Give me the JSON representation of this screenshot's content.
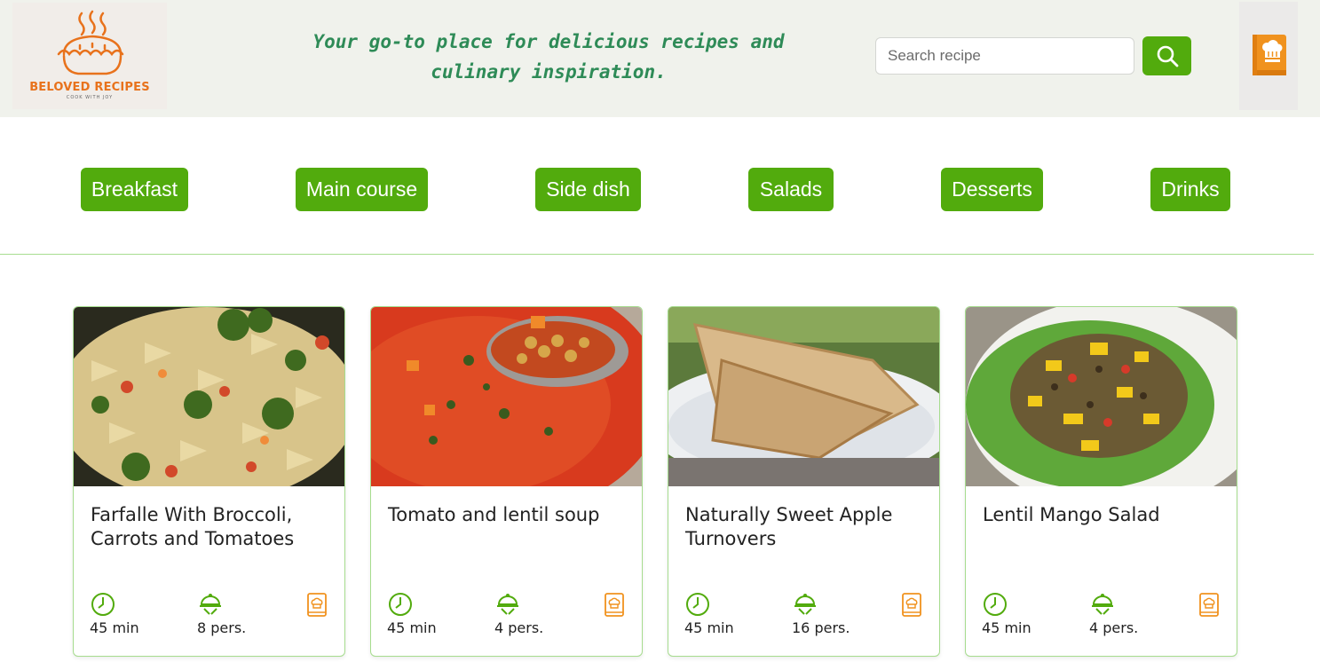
{
  "header": {
    "logo_title": "BELOVED RECIPES",
    "logo_subtitle": "COOK WITH JOY",
    "tagline_line1": "Your go-to place for delicious recipes and",
    "tagline_line2": "culinary inspiration.",
    "search_placeholder": "Search recipe",
    "search_value": ""
  },
  "categories": [
    "Breakfast",
    "Main course",
    "Side dish",
    "Salads",
    "Desserts",
    "Drinks"
  ],
  "recipes": [
    {
      "title": "Farfalle With Broccoli, Carrots and Tomatoes",
      "time": "45 min",
      "servings": "8 pers."
    },
    {
      "title": "Tomato and lentil soup",
      "time": "45 min",
      "servings": "4 pers."
    },
    {
      "title": "Naturally Sweet Apple Turnovers",
      "time": "45 min",
      "servings": "16 pers."
    },
    {
      "title": "Lentil Mango Salad",
      "time": "45 min",
      "servings": "4 pers."
    }
  ],
  "icons": {
    "logo": "pie-icon",
    "search": "search-icon",
    "book": "recipe-book-icon",
    "time": "clock-icon",
    "servings": "serving-cloche-icon"
  },
  "colors": {
    "accent_green": "#52ab0d",
    "tagline_green": "#2e8b57",
    "orange": "#f0921e",
    "header_bg": "#f0f2ec",
    "card_border": "#a6dc8e"
  }
}
